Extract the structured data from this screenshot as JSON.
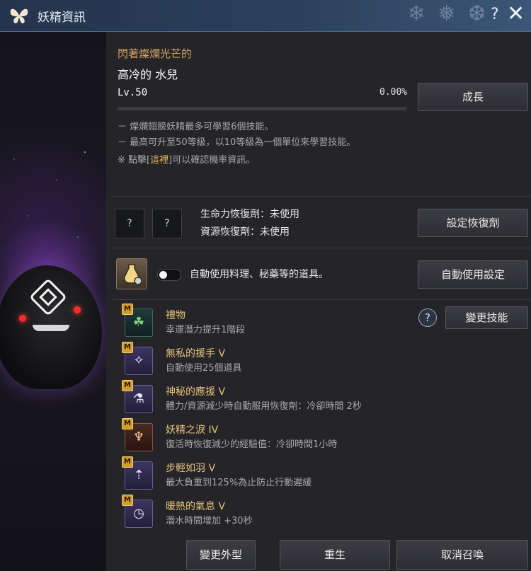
{
  "window": {
    "title": "妖精資訊",
    "help_label": "?",
    "close_label": "✕"
  },
  "fairy": {
    "subtitle": "閃著燦爛光芒的",
    "name": "高冷的 水兒",
    "level": "Lv.50",
    "exp_percent_text": "0.00%",
    "exp_fraction": 0.0,
    "grow_button": "成長"
  },
  "info": {
    "lines": [
      "－ 燦爛翅膀妖精最多可學習6個技能。",
      "－ 最高可升至50等級，以10等級為一個單位來學習技能。"
    ],
    "notice_prefix": "※ 點擊[",
    "notice_link": "這裡",
    "notice_suffix": "]可以確認機率資訊。"
  },
  "recovery": {
    "slot1": "?",
    "slot2": "?",
    "hp_text": "生命力恢復劑：未使用",
    "resource_text": "資源恢復劑：未使用",
    "set_button": "設定恢復劑"
  },
  "auto_use": {
    "enabled": false,
    "text": "自動使用料理、秘藥等的道具。",
    "settings_button": "自動使用設定"
  },
  "skills": {
    "help_label": "?",
    "change_button": "變更技能",
    "badge": "M",
    "items": [
      {
        "name": "禮物",
        "desc": "幸運潛力提升1階段",
        "icon": "clover-icon",
        "glyph": "☘"
      },
      {
        "name": "無私的援手 V",
        "desc": "自動使用25個道具",
        "icon": "fairy-icon",
        "glyph": "✧"
      },
      {
        "name": "神秘的應援 V",
        "desc": "體力/資源減少時自動服用恢復劑：冷卻時間 2秒",
        "icon": "potion-icon",
        "glyph": "⚗"
      },
      {
        "name": "妖精之淚 IV",
        "desc": "復活時恢復減少的經驗值：冷卻時間1小時",
        "icon": "tear-vial-icon",
        "glyph": "♆"
      },
      {
        "name": "步輕如羽 V",
        "desc": "最大負重到125%為止防止行動遲緩",
        "icon": "weight-icon",
        "glyph": "⇡"
      },
      {
        "name": "暖熱的氣息 V",
        "desc": "潛水時間增加 +30秒",
        "icon": "breath-timer-icon",
        "glyph": "◷"
      }
    ]
  },
  "footer": {
    "appearance_button": "變更外型",
    "rebirth_button": "重生",
    "dismiss_button": "取消召喚"
  }
}
